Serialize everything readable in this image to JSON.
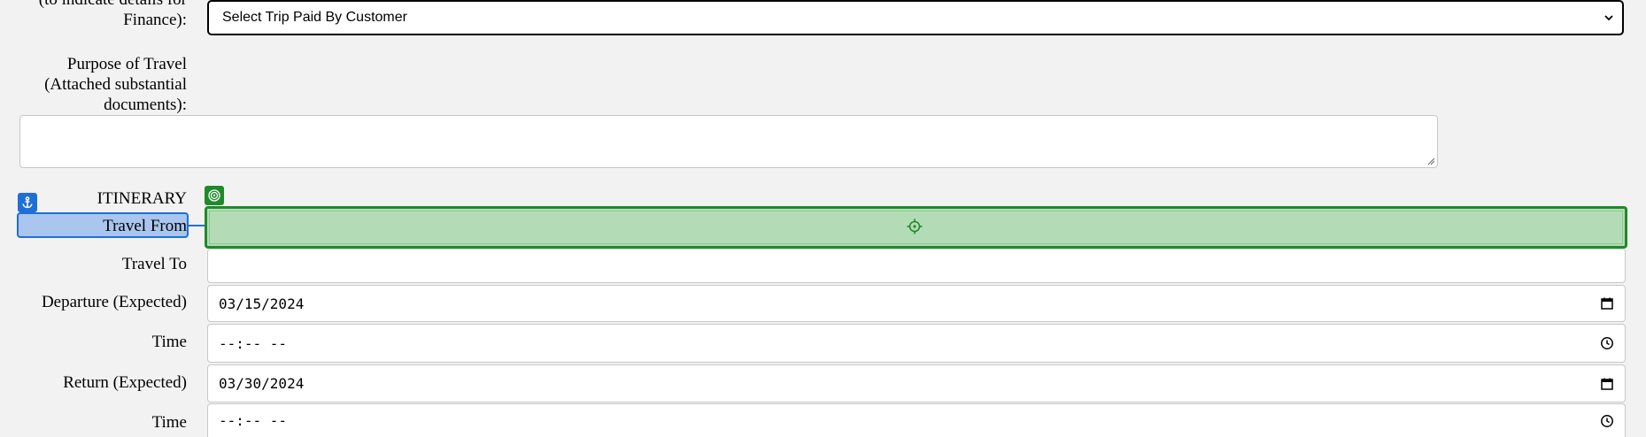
{
  "form": {
    "paid_by": {
      "label_partial": "(to indicate details for",
      "label_end": "Finance):",
      "selected": "Select Trip Paid By Customer"
    },
    "purpose": {
      "label_line1": "Purpose of Travel",
      "label_line2": "(Attached substantial",
      "label_line3": "documents):",
      "value": ""
    },
    "itinerary": {
      "heading": "ITINERARY",
      "travel_from_label": "Travel From",
      "travel_from_value": "",
      "travel_to_label": "Travel To",
      "travel_to_value": "",
      "departure_label": "Departure (Expected)",
      "departure_value": "03/15/2024",
      "departure_time_label": "Time",
      "departure_time_value": "--:-- --",
      "return_label": "Return (Expected)",
      "return_value": "03/30/2024",
      "return_time_label": "Time",
      "return_time_value": "--:-- --"
    }
  },
  "overlay": {
    "anchor_icon": "anchor-icon",
    "target_icon": "target-icon",
    "highlight_label_color": "#1e6fd6",
    "highlight_field_color": "#1f8a2a"
  }
}
